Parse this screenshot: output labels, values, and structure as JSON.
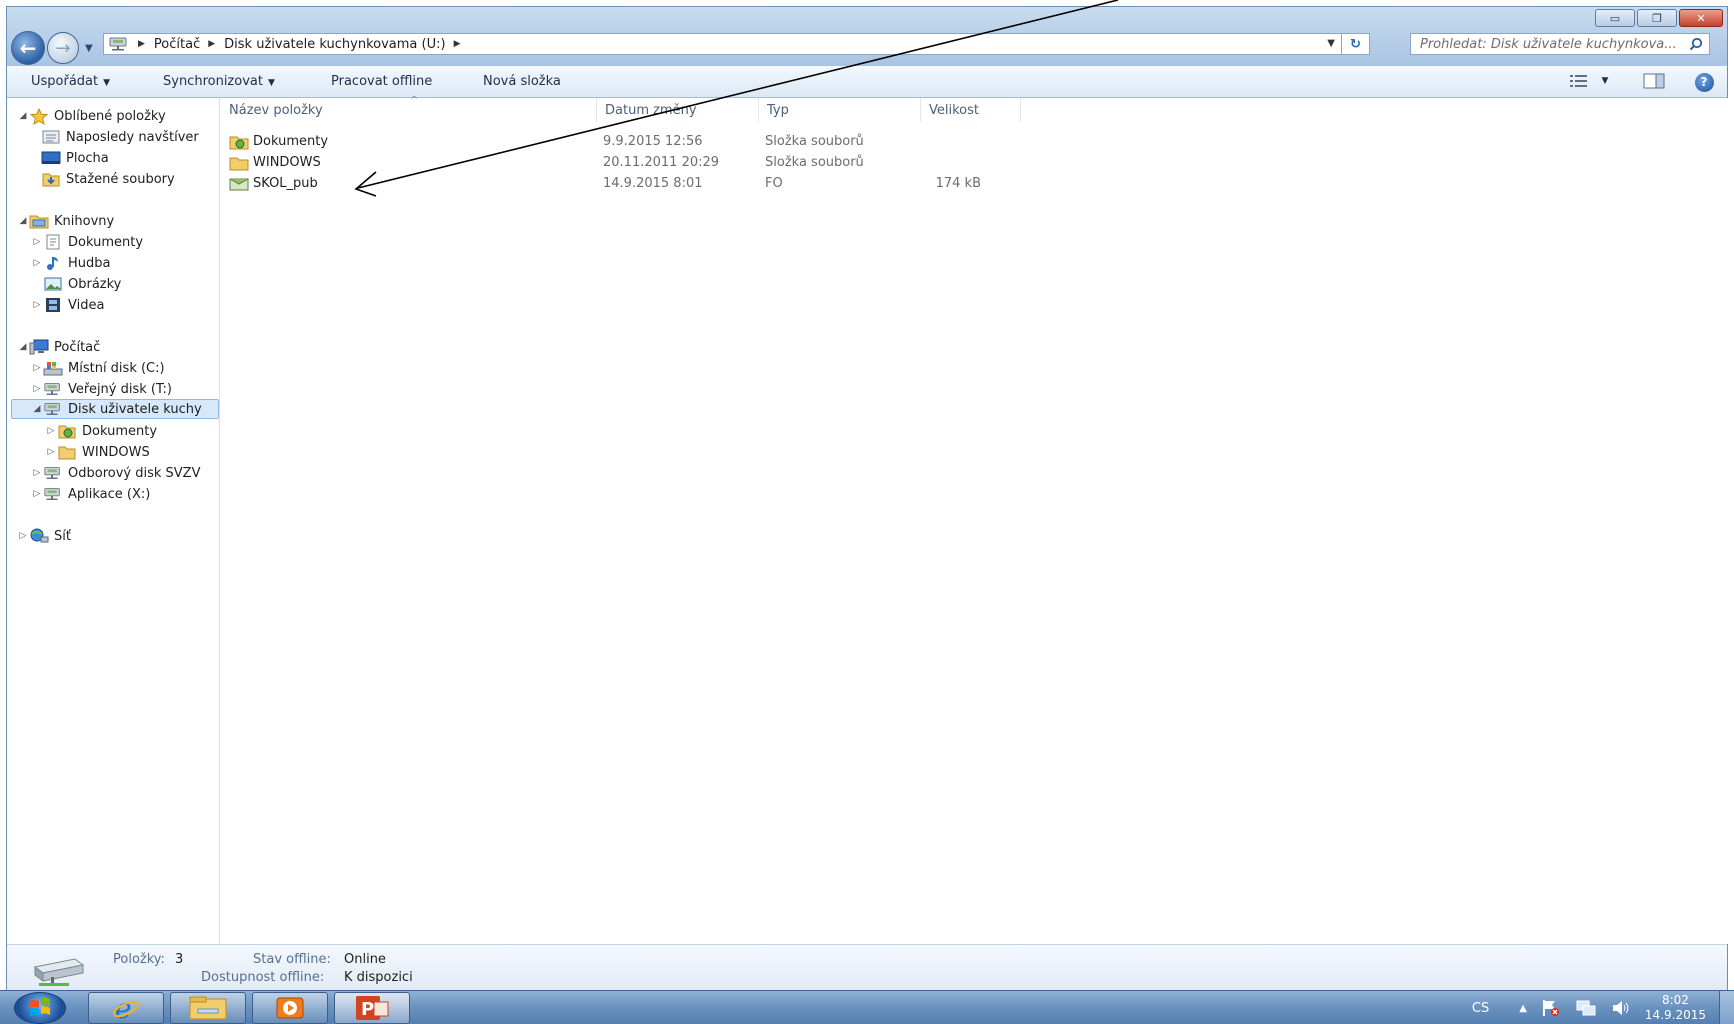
{
  "window": {
    "controls": {
      "minimize": "▭",
      "maximize": "❐",
      "close": "✕"
    }
  },
  "navigation": {
    "back_glyph": "←",
    "forward_glyph": "→",
    "history_dropdown_glyph": "▼"
  },
  "address": {
    "crumbs": [
      "Počítač",
      "Disk uživatele kuchynkovama (U:)"
    ],
    "separator_glyph": "▶",
    "dropdown_glyph": "▼",
    "refresh_glyph": "↻"
  },
  "search": {
    "placeholder": "Prohledat: Disk uživatele kuchynkova..."
  },
  "commandbar": {
    "organize": "Uspořádat",
    "sync": "Synchronizovat",
    "work_offline": "Pracovat offline",
    "new_folder": "Nová složka",
    "caret": "▼",
    "view_caret": "▼",
    "help_glyph": "?"
  },
  "navpane": {
    "favorites": {
      "label": "Oblíbené položky",
      "items": [
        "Naposledy navštíver",
        "Plocha",
        "Stažené soubory"
      ]
    },
    "libraries": {
      "label": "Knihovny",
      "items": [
        "Dokumenty",
        "Hudba",
        "Obrázky",
        "Videa"
      ]
    },
    "computer": {
      "label": "Počítač",
      "drives": [
        "Místní disk (C:)",
        "Veřejný disk (T:)",
        "Disk uživatele kuchy",
        "Odborový disk SVZV",
        "Aplikace (X:)"
      ],
      "subfolders": [
        "Dokumenty",
        "WINDOWS"
      ]
    },
    "network": {
      "label": "Síť"
    },
    "expanded_glyph": "◢",
    "collapsed_glyph": "▷"
  },
  "columns": {
    "name": "Název položky",
    "date": "Datum změny",
    "type": "Typ",
    "size": "Velikost",
    "sort_glyph": "^"
  },
  "files": [
    {
      "name": "Dokumenty",
      "date": "9.9.2015 12:56",
      "type": "Složka souborů",
      "size": ""
    },
    {
      "name": "WINDOWS",
      "date": "20.11.2011 20:29",
      "type": "Složka souborů",
      "size": ""
    },
    {
      "name": "SKOL_pub",
      "date": "14.9.2015 8:01",
      "type": "FO",
      "size": "174 kB"
    }
  ],
  "details": {
    "items_label": "Položky:",
    "items_value": "3",
    "offline_status_label": "Stav offline:",
    "offline_status_value": "Online",
    "offline_availability_label": "Dostupnost offline:",
    "offline_availability_value": "K dispozici"
  },
  "taskbar": {
    "language": "CS",
    "tray_arrow": "▲",
    "time": "8:02",
    "date": "14.9.2015"
  },
  "colors": {
    "accent": "#2a6ab0",
    "selection": "#d7e8fb",
    "taskbar": "#6a92bf"
  }
}
